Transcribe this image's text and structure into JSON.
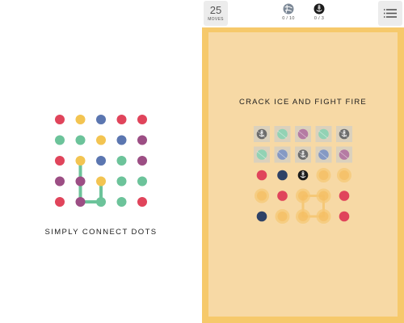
{
  "left_panel": {
    "caption": "SIMPLY CONNECT DOTS",
    "grid": [
      [
        "red",
        "yellow",
        "blue",
        "red",
        "red"
      ],
      [
        "green",
        "green",
        "yellow",
        "blue",
        "purple"
      ],
      [
        "red",
        "yellow",
        "blue",
        "green",
        "purple"
      ],
      [
        "purple",
        "purple",
        "yellow",
        "green",
        "green"
      ],
      [
        "red",
        "purple",
        "green",
        "green",
        "red"
      ]
    ],
    "connected_path": [
      [
        2,
        1
      ],
      [
        3,
        1
      ],
      [
        4,
        1
      ],
      [
        4,
        2
      ],
      [
        3,
        2
      ]
    ]
  },
  "top_bar": {
    "moves_count": "25",
    "moves_label": "MOVES",
    "goals": [
      {
        "icon": "ice-goal-icon",
        "count": "0 / 10"
      },
      {
        "icon": "anchor-goal-icon",
        "count": "0 / 3"
      }
    ],
    "menu_icon": "menu-list-icon"
  },
  "level": {
    "title": "CRACK ICE AND FIGHT FIRE",
    "board": [
      [
        "anchor-ice",
        "green-ice",
        "purple-ice",
        "green-ice",
        "anchor-ice"
      ],
      [
        "green-ice",
        "blue-ice",
        "anchor-ice",
        "blue-ice",
        "purple-ice"
      ],
      [
        "red",
        "blue",
        "anchor",
        "fire",
        "fire"
      ],
      [
        "fire",
        "red",
        "fire",
        "fire",
        "red"
      ],
      [
        "blue",
        "fire",
        "fire",
        "fire",
        "red"
      ]
    ],
    "fire_square_path": [
      [
        3,
        2
      ],
      [
        3,
        3
      ],
      [
        4,
        3
      ],
      [
        4,
        2
      ],
      [
        3,
        2
      ]
    ]
  },
  "colors": {
    "red": "#e0445b",
    "yellow": "#f3c451",
    "blue": "#5b76b0",
    "green": "#6cc39a",
    "purple": "#9c4e84",
    "navy": "#2f4266",
    "anchor": "#1c1c1c",
    "fire": "#f5c877",
    "board_frame": "#f6c96b",
    "board_bg": "#f7d9a5"
  }
}
